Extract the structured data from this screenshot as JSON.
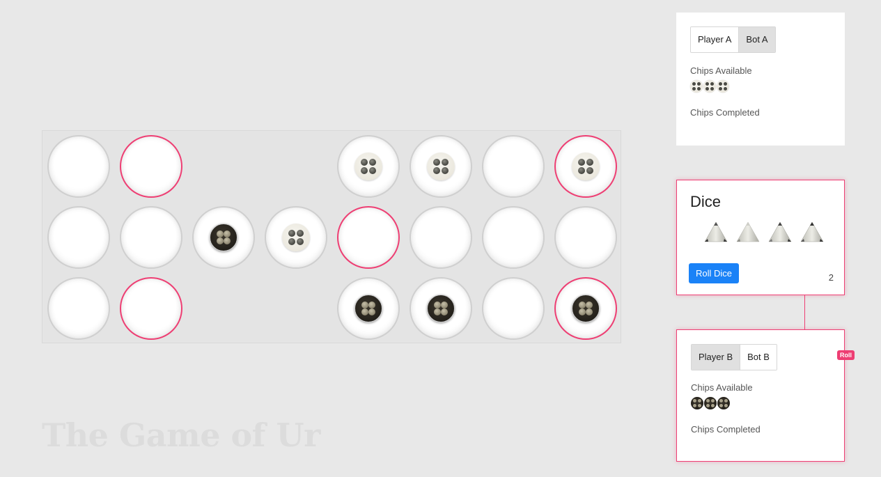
{
  "title": "The Game of Ur",
  "player_a": {
    "options": [
      "Player A",
      "Bot A"
    ],
    "selected": "Bot A",
    "chips_available_label": "Chips Available",
    "chips_available": 3,
    "chips_completed_label": "Chips Completed",
    "chips_completed": 0
  },
  "dice": {
    "title": "Dice",
    "roll_button": "Roll Dice",
    "value": "2",
    "faces": [
      "marked",
      "unmarked",
      "marked",
      "marked"
    ]
  },
  "player_b": {
    "options": [
      "Player B",
      "Bot B"
    ],
    "selected": "Player B",
    "chips_available_label": "Chips Available",
    "chips_available": 3,
    "chips_completed_label": "Chips Completed",
    "chips_completed": 0,
    "badge": "Roll"
  },
  "colors": {
    "rosette": "#ee3e73",
    "roll_button": "#1a82f7",
    "active_panel": "#ee3e73"
  },
  "board": {
    "rows": [
      [
        "empty-rosette-left",
        "rosette",
        "gap",
        "gap",
        "white",
        "white",
        "empty",
        "rosette-white"
      ],
      [
        "empty",
        "empty",
        "black",
        "white",
        "rosette",
        "empty",
        "empty",
        "empty"
      ],
      [
        "empty-rosette-left",
        "rosette",
        "gap",
        "gap",
        "black",
        "black",
        "empty",
        "rosette-black"
      ]
    ]
  }
}
